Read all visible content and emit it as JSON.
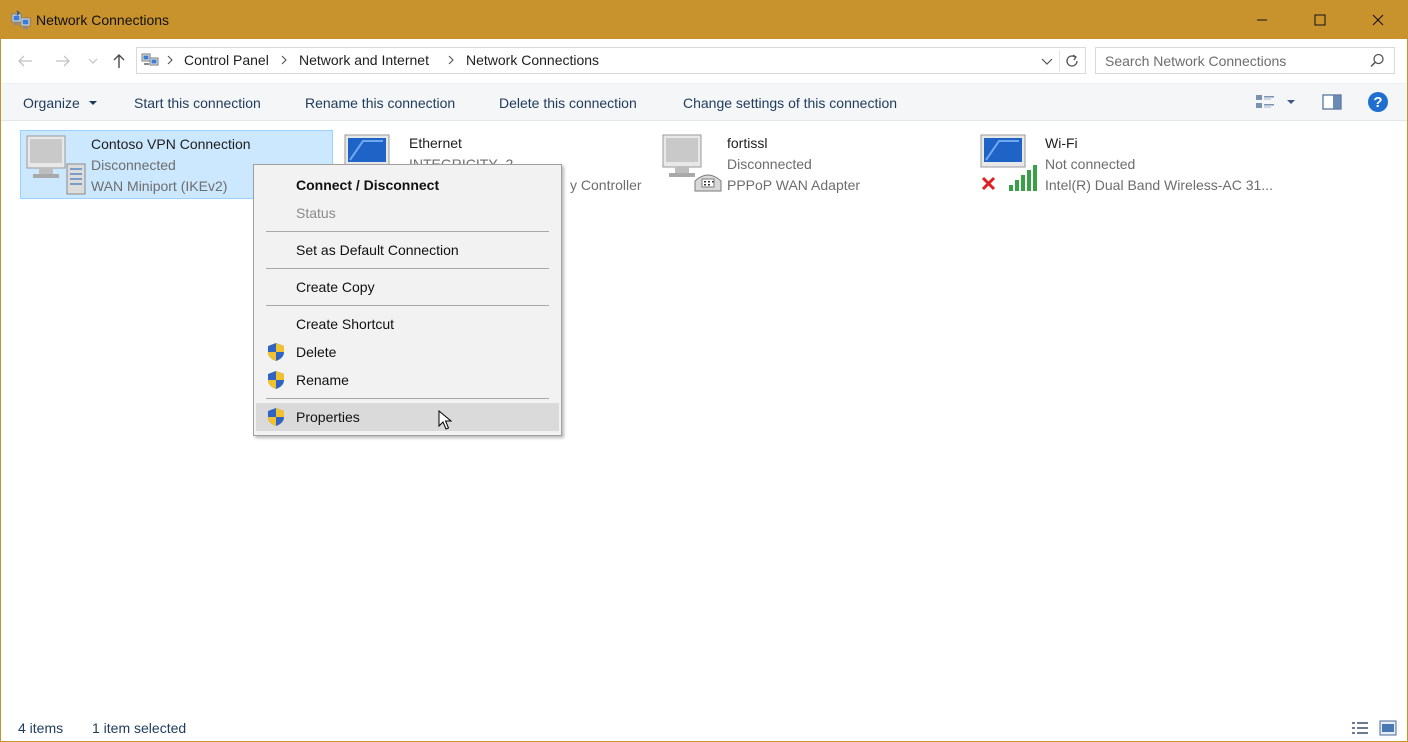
{
  "window": {
    "title": "Network Connections"
  },
  "address": {
    "breadcrumbs": [
      "Control Panel",
      "Network and Internet",
      "Network Connections"
    ]
  },
  "search": {
    "placeholder": "Search Network Connections"
  },
  "commands": {
    "organize": "Organize",
    "start": "Start this connection",
    "rename": "Rename this connection",
    "delete": "Delete this connection",
    "change": "Change settings of this connection"
  },
  "connections": [
    {
      "name": "Contoso VPN Connection",
      "status": "Disconnected",
      "device": "WAN Miniport (IKEv2)",
      "selected": true
    },
    {
      "name": "Ethernet",
      "status": "INTEGRICITY_2",
      "device": "y Controller",
      "selected": false
    },
    {
      "name": "fortissl",
      "status": "Disconnected",
      "device": "PPPoP WAN Adapter",
      "selected": false
    },
    {
      "name": "Wi-Fi",
      "status": "Not connected",
      "device": "Intel(R) Dual Band Wireless-AC 31...",
      "selected": false
    }
  ],
  "context_menu": {
    "items": [
      {
        "label": "Connect / Disconnect",
        "style": "bold"
      },
      {
        "label": "Status",
        "style": "disabled"
      },
      {
        "label": "Set as Default Connection"
      },
      {
        "label": "Create Copy"
      },
      {
        "label": "Create Shortcut"
      },
      {
        "label": "Delete",
        "icon": "uac-shield-icon"
      },
      {
        "label": "Rename",
        "icon": "uac-shield-icon"
      },
      {
        "label": "Properties",
        "icon": "uac-shield-icon",
        "state": "hover"
      }
    ]
  },
  "statusbar": {
    "item_count": "4 items",
    "selection": "1 item selected"
  },
  "colors": {
    "titlebar": "#c8922c",
    "selection": "#cce8ff",
    "selection_border": "#99d1ff",
    "command_text": "#1e3b5c"
  }
}
